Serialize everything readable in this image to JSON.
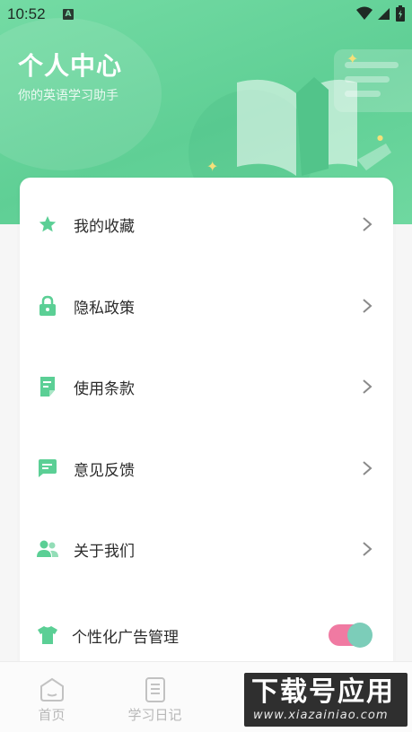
{
  "status_bar": {
    "time": "10:52",
    "badge": "A"
  },
  "header": {
    "title": "个人中心",
    "subtitle": "你的英语学习助手"
  },
  "menu": [
    {
      "label": "我的收藏",
      "icon": "star-icon"
    },
    {
      "label": "隐私政策",
      "icon": "lock-icon"
    },
    {
      "label": "使用条款",
      "icon": "document-icon"
    },
    {
      "label": "意见反馈",
      "icon": "feedback-icon"
    },
    {
      "label": "关于我们",
      "icon": "users-icon"
    }
  ],
  "ad_setting": {
    "label": "个性化广告管理",
    "icon": "shirt-icon",
    "enabled": true
  },
  "bottom_nav": [
    {
      "label": "首页",
      "icon": "home-icon"
    },
    {
      "label": "学习日记",
      "icon": "diary-icon"
    }
  ],
  "watermark": {
    "main": "下载号应用",
    "sub": "www.xiazainiao.com"
  },
  "colors": {
    "accent": "#5fcf95",
    "icon_green": "#5bcf95",
    "toggle_track": "#f07aa2",
    "toggle_knob": "#7ccdb9"
  }
}
